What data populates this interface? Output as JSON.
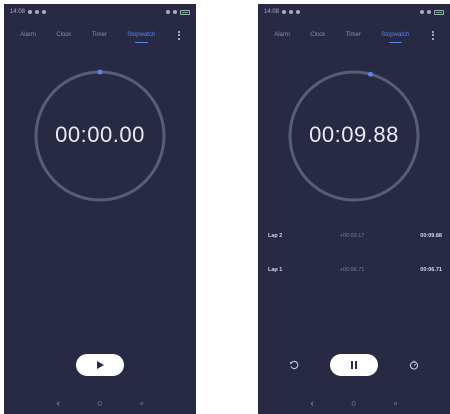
{
  "screens": [
    {
      "status": {
        "time": "14:08"
      },
      "tabs": [
        {
          "label": "Alarm",
          "active": false
        },
        {
          "label": "Clock",
          "active": false
        },
        {
          "label": "Timer",
          "active": false
        },
        {
          "label": "Stopwatch",
          "active": true
        }
      ],
      "stopwatch": {
        "time": "00:00.00",
        "running": false
      },
      "laps": [],
      "controls": {
        "primary_icon": "play-icon"
      },
      "nav": {
        "back": "‹",
        "home": "○",
        "recents": "▫"
      }
    },
    {
      "status": {
        "time": "14:08"
      },
      "tabs": [
        {
          "label": "Alarm",
          "active": false
        },
        {
          "label": "Clock",
          "active": false
        },
        {
          "label": "Timer",
          "active": false
        },
        {
          "label": "Stopwatch",
          "active": true
        }
      ],
      "stopwatch": {
        "time": "00:09.88",
        "running": true
      },
      "laps": [
        {
          "name": "Lap 2",
          "split": "+00:03.17",
          "total": "00:09.88"
        },
        {
          "name": "Lap 1",
          "split": "+00:06.71",
          "total": "00:06.71"
        }
      ],
      "controls": {
        "primary_icon": "pause-icon",
        "left_icon": "reset-icon",
        "right_icon": "lap-icon"
      },
      "nav": {
        "back": "‹",
        "home": "○",
        "recents": "▫"
      }
    }
  ],
  "colors": {
    "background": "#282a44",
    "accent": "#5c82f0",
    "ring": "#5b5d75",
    "text": "#e9eaf4"
  }
}
